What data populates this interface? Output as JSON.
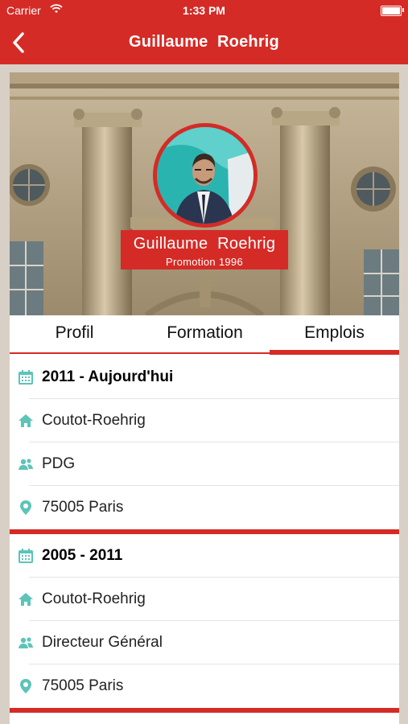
{
  "status_bar": {
    "carrier": "Carrier",
    "time": "1:33 PM"
  },
  "nav": {
    "title": "Guillaume  Roehrig",
    "back_icon": "chevron-left-icon"
  },
  "profile": {
    "name": "Guillaume  Roehrig",
    "promotion": "Promotion 1996"
  },
  "tabs": [
    {
      "label": "Profil",
      "active": false
    },
    {
      "label": "Formation",
      "active": false
    },
    {
      "label": "Emplois",
      "active": true
    }
  ],
  "jobs": [
    {
      "period": "2011 - Aujourd'hui",
      "company": "Coutot-Roehrig",
      "role": "PDG",
      "location": "75005 Paris"
    },
    {
      "period": "2005 - 2011",
      "company": "Coutot-Roehrig",
      "role": "Directeur Général",
      "location": "75005 Paris"
    }
  ],
  "colors": {
    "accent": "#d52b26",
    "icon": "#5cc4b8"
  },
  "icons": {
    "period": "calendar-icon",
    "company": "home-icon",
    "role": "people-icon",
    "location": "location-pin-icon"
  }
}
